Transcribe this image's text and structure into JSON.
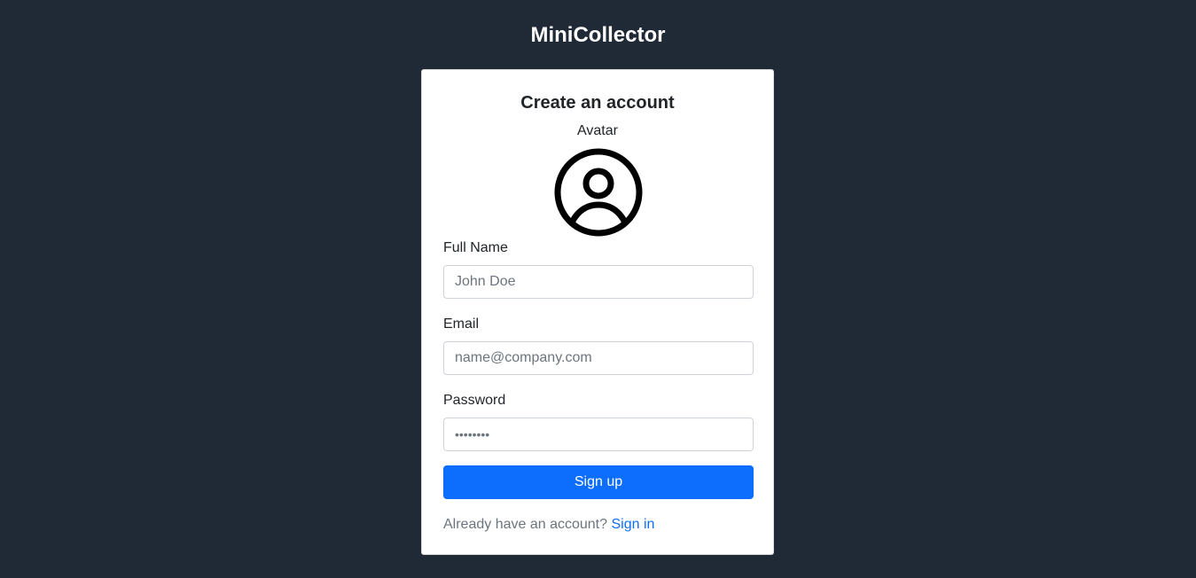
{
  "app": {
    "title": "MiniCollector"
  },
  "form": {
    "heading": "Create an account",
    "avatar_label": "Avatar",
    "avatar_icon": "user-circle-icon",
    "full_name": {
      "label": "Full Name",
      "placeholder": "John Doe",
      "value": ""
    },
    "email": {
      "label": "Email",
      "placeholder": "name@company.com",
      "value": ""
    },
    "password": {
      "label": "Password",
      "placeholder": "••••••••",
      "value": ""
    },
    "submit_label": "Sign up",
    "footer_text": "Already have an account?",
    "footer_link": "Sign in"
  },
  "colors": {
    "background": "#202936",
    "card": "#ffffff",
    "primary": "#0d6efd",
    "text": "#212529",
    "muted": "#6c757d"
  }
}
